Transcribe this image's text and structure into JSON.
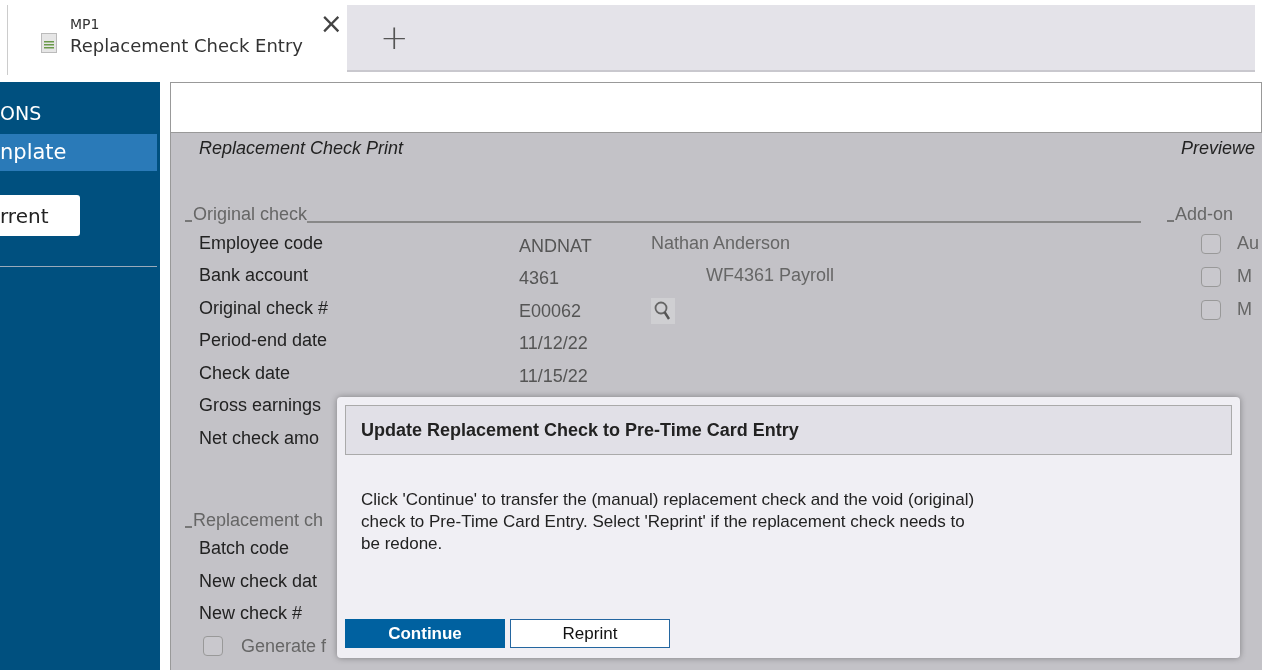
{
  "tabs": [
    {
      "subtitle": "MP1",
      "title": "Replacement Check Entry",
      "selected": true,
      "close": "×"
    }
  ],
  "new_tab": "+",
  "sidebar": {
    "heading": "ONS",
    "items": [
      {
        "label": "nplate",
        "selected": true
      }
    ],
    "button": "rrent"
  },
  "form": {
    "title": "Replacement Check Print",
    "side_title": "Previewe",
    "original_check": {
      "legend": "Original check",
      "rows": [
        {
          "label": "Employee code",
          "value": "ANDNAT",
          "description": "Nathan Anderson",
          "kind": "name"
        },
        {
          "label": "Bank account",
          "value": "4361",
          "description": "WF4361 Payroll",
          "kind": "account"
        },
        {
          "label": "Original check #",
          "value": "E00062",
          "lookup": true
        },
        {
          "label": "Period-end date",
          "value": "11/12/22"
        },
        {
          "label": "Check date",
          "value": "11/15/22"
        },
        {
          "label": "Gross earnings"
        },
        {
          "label": "Net check amo"
        }
      ]
    },
    "add_on": {
      "legend": "Add-on",
      "options": [
        {
          "label": "Au",
          "checked": false
        },
        {
          "label": "M",
          "checked": false
        },
        {
          "label": "M",
          "checked": false
        }
      ]
    },
    "replacement_check": {
      "legend": "Replacement ch",
      "rows": [
        {
          "label": "Batch code"
        },
        {
          "label": "New check dat"
        },
        {
          "label": "New check #"
        }
      ],
      "option": {
        "label": "Generate f",
        "checked": false
      }
    }
  },
  "dialog": {
    "title": "Update Replacement Check to Pre-Time Card Entry",
    "message": "Click 'Continue' to transfer the (manual) replacement check and the void (original) check to Pre-Time Card Entry. Select 'Reprint' if the replacement check needs to be redone.",
    "buttons": [
      {
        "label": "Continue",
        "kind": "primary"
      },
      {
        "label": "Reprint",
        "kind": "secondary"
      }
    ]
  }
}
